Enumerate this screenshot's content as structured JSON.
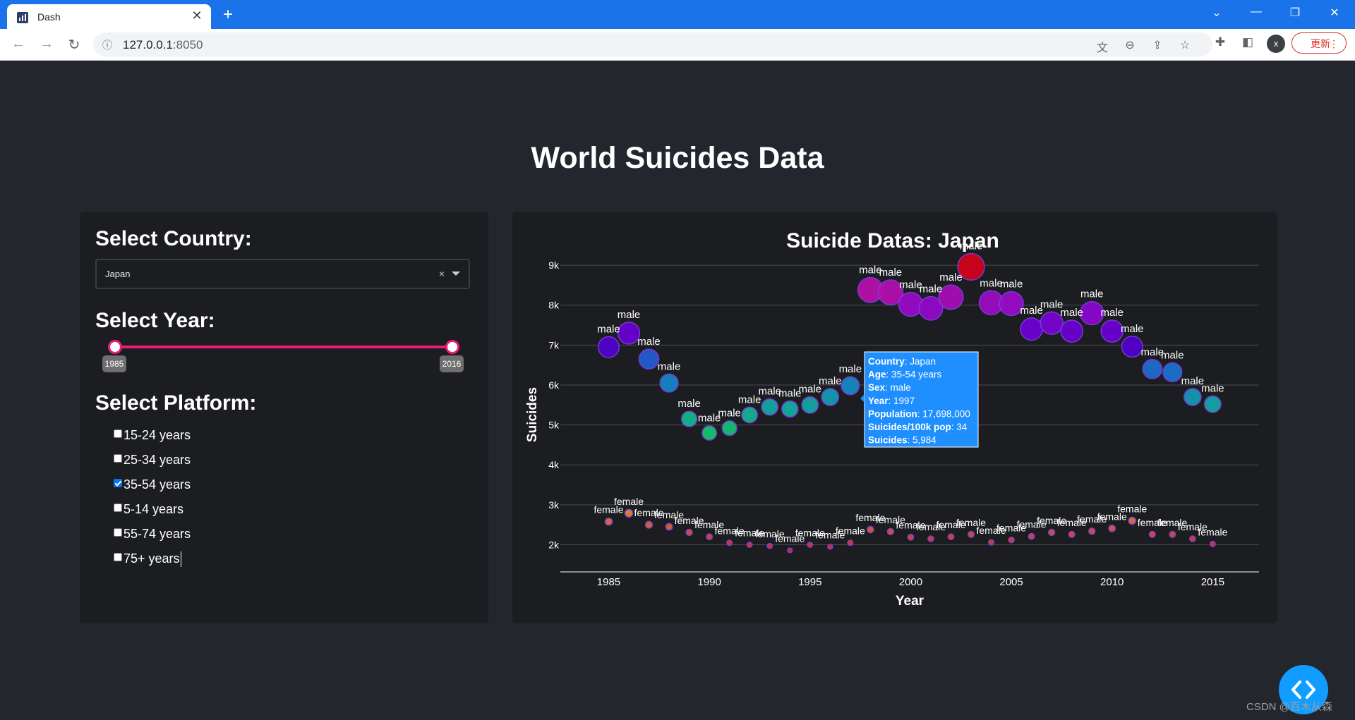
{
  "browser": {
    "tab_title": "Dash",
    "url_host": "127.0.0.1",
    "url_port": ":8050",
    "update_label": "更新"
  },
  "app": {
    "title": "World Suicides Data",
    "country_label": "Select Country:",
    "country_value": "Japan",
    "year_label": "Select Year:",
    "year_min": "1985",
    "year_max": "2016",
    "platform_label": "Select Platform:",
    "platforms": [
      {
        "label": "15-24 years",
        "checked": false
      },
      {
        "label": "25-34 years",
        "checked": false
      },
      {
        "label": "35-54 years",
        "checked": true
      },
      {
        "label": "5-14 years",
        "checked": false
      },
      {
        "label": "55-74 years",
        "checked": false
      },
      {
        "label": "75+ years",
        "checked": false
      }
    ]
  },
  "watermark": "CSDN @百木从森",
  "chart_data": {
    "type": "scatter",
    "title": "Suicide Datas: Japan",
    "xlabel": "Year",
    "ylabel": "Suicides",
    "xlim": [
      1982.6,
      2017.3
    ],
    "ylim": [
      1320,
      9620
    ],
    "x_ticks": [
      1985,
      1990,
      1995,
      2000,
      2005,
      2010,
      2015
    ],
    "y_ticks": [
      2000,
      3000,
      4000,
      5000,
      6000,
      7000,
      8000,
      9000
    ],
    "y_tick_labels": [
      "2k",
      "3k",
      "4k",
      "5k",
      "6k",
      "7k",
      "8k",
      "9k"
    ],
    "grid": true,
    "series": [
      {
        "name": "male",
        "x": [
          1985,
          1986,
          1987,
          1988,
          1989,
          1990,
          1991,
          1992,
          1993,
          1994,
          1995,
          1996,
          1997,
          1998,
          1999,
          2000,
          2001,
          2002,
          2003,
          2004,
          2005,
          2006,
          2007,
          2008,
          2009,
          2010,
          2011,
          2012,
          2013,
          2014,
          2015
        ],
        "y": [
          6950,
          7300,
          6650,
          6050,
          5150,
          4800,
          4920,
          5250,
          5450,
          5400,
          5500,
          5700,
          5984,
          8380,
          8320,
          8020,
          7920,
          8200,
          8960,
          8060,
          8040,
          7400,
          7550,
          7350,
          7800,
          7350,
          6960,
          6400,
          6320,
          5700,
          5520
        ]
      },
      {
        "name": "female",
        "x": [
          1985,
          1986,
          1987,
          1988,
          1989,
          1990,
          1991,
          1992,
          1993,
          1994,
          1995,
          1996,
          1997,
          1998,
          1999,
          2000,
          2001,
          2002,
          2003,
          2004,
          2005,
          2006,
          2007,
          2008,
          2009,
          2010,
          2011,
          2012,
          2013,
          2014,
          2015
        ],
        "y": [
          2580,
          2790,
          2500,
          2450,
          2310,
          2200,
          2050,
          2000,
          1970,
          1860,
          2000,
          1950,
          2050,
          2380,
          2330,
          2190,
          2150,
          2200,
          2260,
          2060,
          2120,
          2210,
          2310,
          2260,
          2340,
          2410,
          2600,
          2260,
          2260,
          2150,
          2020
        ]
      }
    ],
    "tooltip": {
      "rows": [
        {
          "k": "Country",
          "v": "Japan"
        },
        {
          "k": "Age",
          "v": "35-54 years"
        },
        {
          "k": "Sex",
          "v": "male"
        },
        {
          "k": "Year",
          "v": "1997"
        },
        {
          "k": "Population",
          "v": "17,698,000"
        },
        {
          "k": "Suicides/100k pop",
          "v": "34"
        },
        {
          "k": "Suicides",
          "v": "5,984"
        }
      ]
    }
  }
}
